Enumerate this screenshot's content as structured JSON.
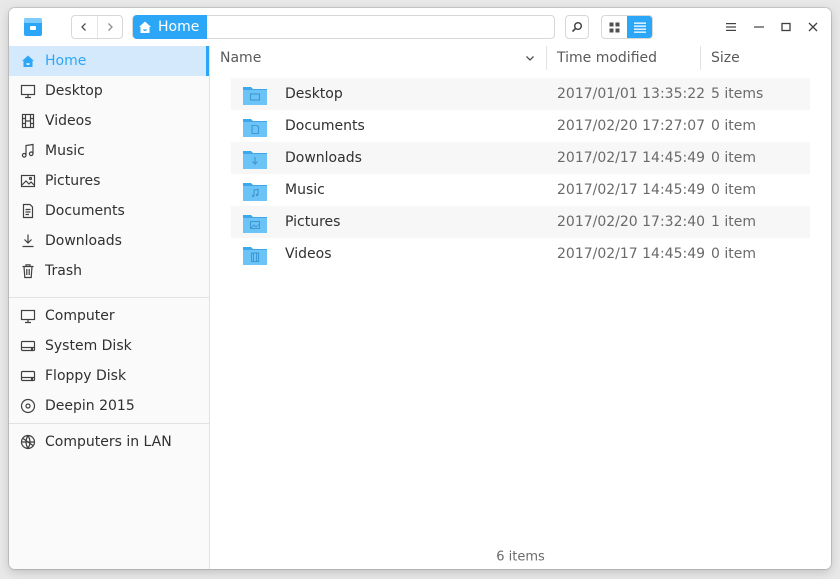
{
  "colors": {
    "accent": "#2ca7f8",
    "sidebar_active_bg": "#d5e9fd",
    "folder": "#4fb3f0"
  },
  "breadcrumb": {
    "home_label": "Home",
    "home_icon": "home-icon"
  },
  "toolbar": {
    "back_icon": "chevron-left-icon",
    "forward_icon": "chevron-right-icon",
    "search_icon": "search-icon",
    "icon_view_icon": "grid-view-icon",
    "list_view_icon": "list-view-icon",
    "active_view": "list"
  },
  "window_controls": [
    "menu-icon",
    "minimize-icon",
    "maximize-icon",
    "close-icon"
  ],
  "sidebar": {
    "items": [
      {
        "label": "Home",
        "icon": "home-icon",
        "active": true
      },
      {
        "label": "Desktop",
        "icon": "desktop-icon"
      },
      {
        "label": "Videos",
        "icon": "film-icon"
      },
      {
        "label": "Music",
        "icon": "music-note-icon"
      },
      {
        "label": "Pictures",
        "icon": "picture-icon"
      },
      {
        "label": "Documents",
        "icon": "document-icon"
      },
      {
        "label": "Downloads",
        "icon": "download-icon"
      },
      {
        "label": "Trash",
        "icon": "trash-icon"
      },
      {
        "label": "Computer",
        "icon": "computer-icon"
      },
      {
        "label": "System Disk",
        "icon": "disk-icon"
      },
      {
        "label": "Floppy Disk",
        "icon": "disk-icon"
      },
      {
        "label": "Deepin 2015",
        "icon": "optical-disc-icon"
      },
      {
        "label": "Computers in LAN",
        "icon": "network-globe-icon"
      }
    ]
  },
  "file_list": {
    "columns": {
      "name": "Name",
      "time": "Time modified",
      "size": "Size"
    },
    "rows": [
      {
        "name": "Desktop",
        "time": "2017/01/01 13:35:22",
        "size": "5 items"
      },
      {
        "name": "Documents",
        "time": "2017/02/20 17:27:07",
        "size": "0 item"
      },
      {
        "name": "Downloads",
        "time": "2017/02/17 14:45:49",
        "size": "0 item"
      },
      {
        "name": "Music",
        "time": "2017/02/17 14:45:49",
        "size": "0 item"
      },
      {
        "name": "Pictures",
        "time": "2017/02/20 17:32:40",
        "size": "1 item"
      },
      {
        "name": "Videos",
        "time": "2017/02/17 14:45:49",
        "size": "0 item"
      }
    ]
  },
  "status_bar": {
    "text": "6 items"
  }
}
